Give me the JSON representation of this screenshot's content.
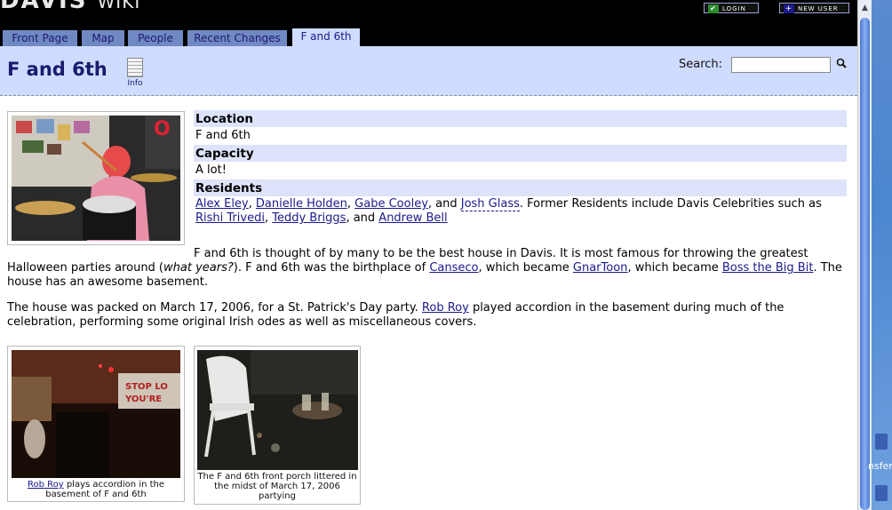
{
  "header": {
    "logo_text": "DAVIS",
    "logo_sub": "WIKI",
    "login_label": "LOGIN",
    "new_user_label": "NEW USER",
    "tabs": [
      {
        "label": "Front Page"
      },
      {
        "label": "Map"
      },
      {
        "label": "People"
      },
      {
        "label": "Recent Changes"
      },
      {
        "label": "F and 6th",
        "active": true
      }
    ]
  },
  "page": {
    "title": "F and 6th",
    "info_label": "Info",
    "search_label": "Search:",
    "search_value": ""
  },
  "infobox": {
    "location_head": "Location",
    "location_value": "F and 6th",
    "capacity_head": "Capacity",
    "capacity_value": "A lot!",
    "residents_head": "Residents",
    "residents": [
      "Alex Eley",
      "Danielle Holden",
      "Gabe Cooley",
      "Josh Glass"
    ],
    "sep1": ", ",
    "sep_and": ", and ",
    "former_text": ". Former Residents include Davis Celebrities such as ",
    "former": [
      "Rishi Trivedi",
      "Teddy Briggs",
      "Andrew Bell"
    ]
  },
  "body": {
    "p1_a": "F and 6th is thought of by many to be the best house in Davis. It is most famous for throwing the greatest Halloween parties around (",
    "p1_em": "what years?",
    "p1_b": "). F and 6th was the birthplace of ",
    "p1_link1": "Canseco",
    "p1_c": ", which became ",
    "p1_link2": "GnarToon",
    "p1_d": ", which became ",
    "p1_link3": "Boss the Big Bit",
    "p1_e": ". The house has an awesome basement.",
    "p2_a": "The house was packed on March 17, 2006, for a St. Patrick's Day party. ",
    "p2_link": "Rob Roy",
    "p2_b": " played accordion in the basement during much of the celebration, performing some original Irish odes as well as miscellaneous covers."
  },
  "gallery": {
    "caption1_link": "Rob Roy",
    "caption1_rest": " plays accordion in the basement of F and 6th",
    "caption2": "The F and 6th front porch littered in the midst of March 17, 2006 partying"
  },
  "desktop": {
    "label": "nsfer"
  }
}
